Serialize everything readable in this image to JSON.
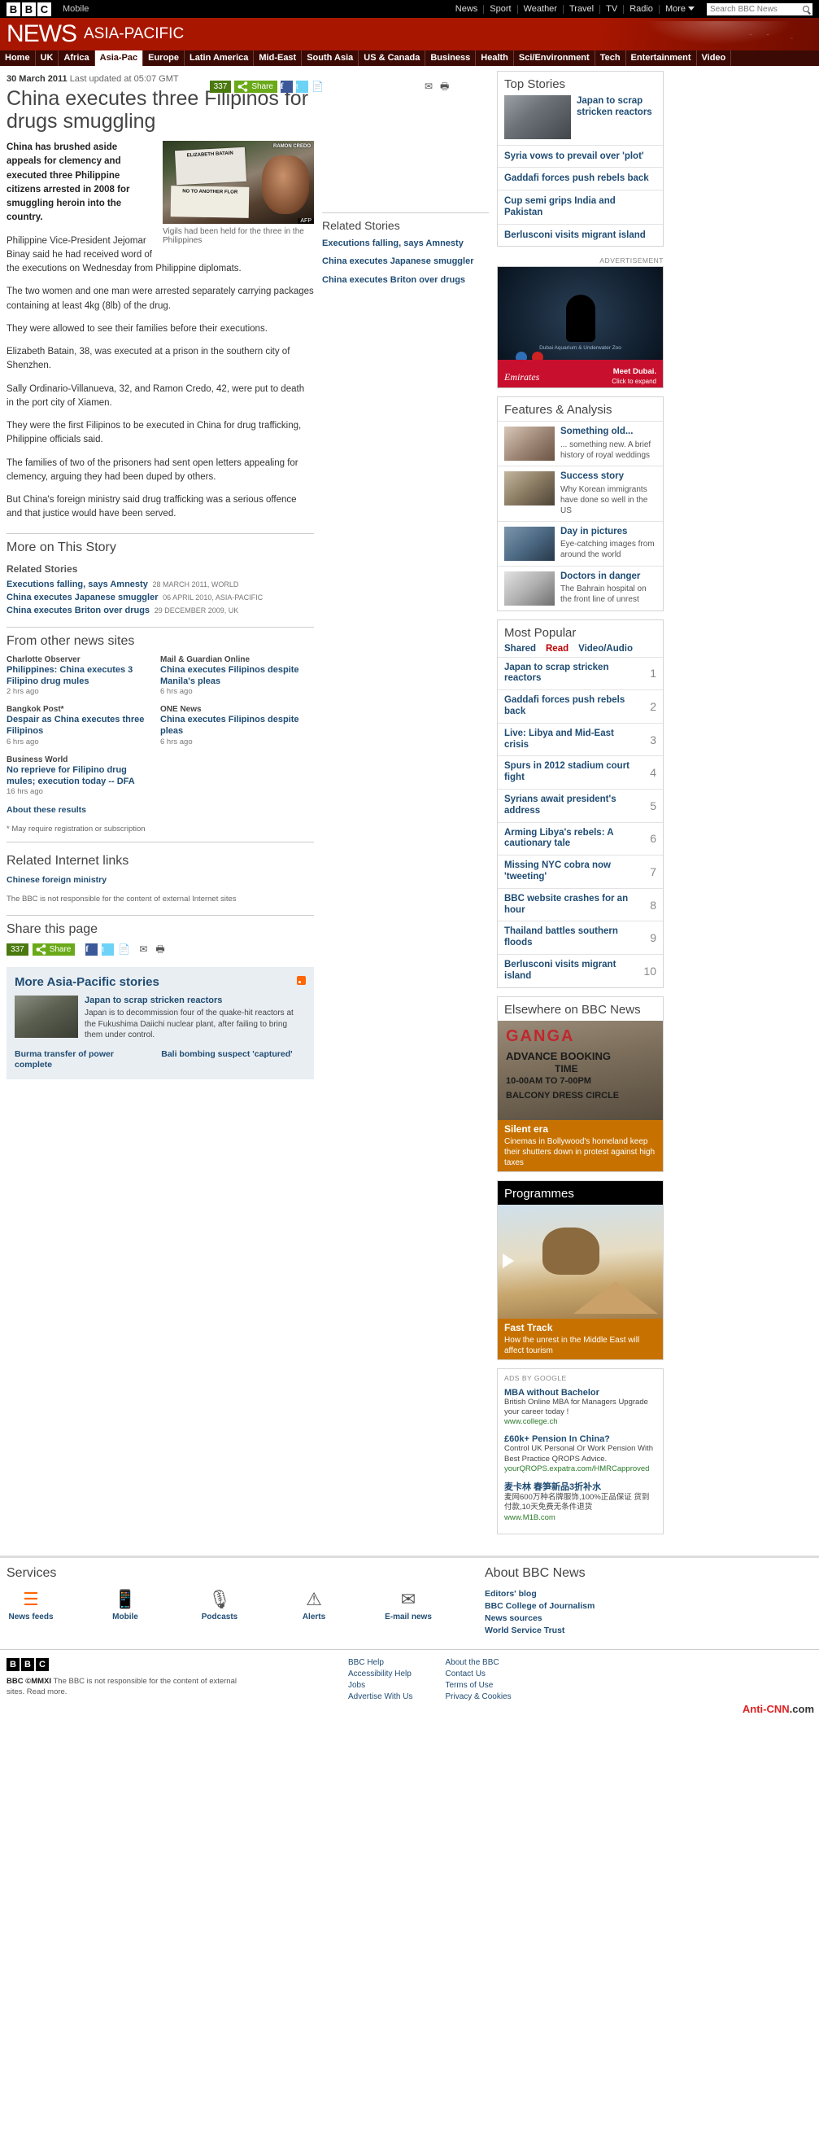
{
  "globalbar": {
    "logo_letters": [
      "B",
      "B",
      "C"
    ],
    "mobile_label": "Mobile",
    "nav": [
      "News",
      "Sport",
      "Weather",
      "Travel",
      "TV",
      "Radio",
      "More"
    ],
    "search_placeholder": "Search BBC News"
  },
  "masthead": {
    "brand": "NEWS",
    "section": "ASIA-PACIFIC"
  },
  "sectionnav": {
    "items": [
      {
        "label": "Home",
        "active": false
      },
      {
        "label": "UK",
        "active": false
      },
      {
        "label": "Africa",
        "active": false
      },
      {
        "label": "Asia-Pac",
        "active": true
      },
      {
        "label": "Europe",
        "active": false
      },
      {
        "label": "Latin America",
        "active": false
      },
      {
        "label": "Mid-East",
        "active": false
      },
      {
        "label": "South Asia",
        "active": false
      },
      {
        "label": "US & Canada",
        "active": false
      },
      {
        "label": "Business",
        "active": false
      },
      {
        "label": "Health",
        "active": false
      },
      {
        "label": "Sci/Environment",
        "active": false
      },
      {
        "label": "Tech",
        "active": false
      },
      {
        "label": "Entertainment",
        "active": false
      },
      {
        "label": "Video",
        "active": false
      }
    ]
  },
  "story": {
    "date": "30 March 2011",
    "updated": "Last updated at 05:07 GMT",
    "headline": "China executes three Filipinos for drugs smuggling",
    "share": {
      "count": "337",
      "label": "Share"
    },
    "figure": {
      "placard_text": "ELIZABETH BATAIN",
      "placard2_text": "NO TO ANOTHER FLOR",
      "nameplate": "RAMON CREDO",
      "agency": "AFP",
      "caption": "Vigils had been held for the three in the Philippines"
    },
    "paragraphs": [
      "China has brushed aside appeals for clemency and executed three Philippine citizens arrested in 2008 for smuggling heroin into the country.",
      "Philippine Vice-President Jejomar Binay said he had received word of the executions on Wednesday from Philippine diplomats.",
      "The two women and one man were arrested separately carrying packages containing at least 4kg (8lb) of the drug.",
      "They were allowed to see their families before their executions.",
      "Elizabeth Batain, 38, was executed at a prison in the southern city of Shenzhen.",
      "Sally Ordinario-Villanueva, 32, and Ramon Credo, 42, were put to death in the port city of Xiamen.",
      "They were the first Filipinos to be executed in China for drug trafficking, Philippine officials said.",
      "The families of two of the prisoners had sent open letters appealing for clemency, arguing they had been duped by others.",
      "But China's foreign ministry said drug trafficking was a serious offence and that justice would have been served."
    ],
    "more_heading": "More on This Story",
    "related_heading": "Related Stories",
    "related": [
      {
        "title": "Executions falling, says Amnesty",
        "meta": "28 MARCH 2011, WORLD"
      },
      {
        "title": "China executes Japanese smuggler",
        "meta": "06 APRIL 2010, ASIA-PACIFIC"
      },
      {
        "title": "China executes Briton over drugs",
        "meta": "29 DECEMBER 2009, UK"
      }
    ],
    "othersites_heading": "From other news sites",
    "othersites": [
      {
        "source": "Charlotte Observer",
        "title": "Philippines: China executes 3 Filipino drug mules",
        "age": "2 hrs ago"
      },
      {
        "source": "Mail & Guardian Online",
        "title": "China executes Filipinos despite Manila's pleas",
        "age": "6 hrs ago"
      },
      {
        "source": "Bangkok Post*",
        "title": "Despair as China executes three Filipinos",
        "age": "6 hrs ago"
      },
      {
        "source": "ONE News",
        "title": "China executes Filipinos despite pleas",
        "age": "6 hrs ago"
      },
      {
        "source": "Business World",
        "title": "No reprieve for Filipino drug mules; execution today -- DFA",
        "age": "16 hrs ago"
      }
    ],
    "about_results": "About these results",
    "registration_note": "* May require registration or subscription",
    "internet_links_heading": "Related Internet links",
    "internet_links": [
      "Chinese foreign ministry"
    ],
    "disclaimer": "The BBC is not responsible for the content of external Internet sites",
    "share_page_heading": "Share this page"
  },
  "related_column": {
    "heading": "Related Stories",
    "items": [
      "Executions falling, says Amnesty",
      "China executes Japanese smuggler",
      "China executes Briton over drugs"
    ]
  },
  "more_stories": {
    "heading": "More Asia-Pacific stories",
    "rss": "rss-icon",
    "lead_title": "Japan to scrap stricken reactors",
    "lead_summary": "Japan is to decommission four of the quake-hit reactors at the Fukushima Daiichi nuclear plant, after failing to bring them under control.",
    "links": [
      "Burma transfer of power complete",
      "Bali bombing suspect 'captured'"
    ]
  },
  "top_stories": {
    "heading": "Top Stories",
    "lead": "Japan to scrap stricken reactors",
    "items": [
      "Syria vows to prevail over 'plot'",
      "Gaddafi forces push rebels back",
      "Cup semi grips India and Pakistan",
      "Berlusconi visits migrant island"
    ]
  },
  "advert": {
    "label": "ADVERTISEMENT",
    "caption": "Dubai Aquarium & Underwater Zoo",
    "brand": "Emirates",
    "cta_line1": "Meet Dubai.",
    "cta_line2": "Click to expand"
  },
  "features": {
    "heading": "Features & Analysis",
    "items": [
      {
        "title": "Something old...",
        "desc": "... something new. A brief history of royal weddings"
      },
      {
        "title": "Success story",
        "desc": "Why Korean immigrants have done so well in the US"
      },
      {
        "title": "Day in pictures",
        "desc": "Eye-catching images from around the world"
      },
      {
        "title": "Doctors in danger",
        "desc": "The Bahrain hospital on the front line of unrest"
      }
    ]
  },
  "most_popular": {
    "heading": "Most Popular",
    "tabs": [
      {
        "label": "Shared",
        "active": false
      },
      {
        "label": "Read",
        "active": true
      },
      {
        "label": "Video/Audio",
        "active": false
      }
    ],
    "items": [
      {
        "rank": "1",
        "title": "Japan to scrap stricken reactors"
      },
      {
        "rank": "2",
        "title": "Gaddafi forces push rebels back"
      },
      {
        "rank": "3",
        "title": "Live: Libya and Mid-East crisis"
      },
      {
        "rank": "4",
        "title": "Spurs in 2012 stadium court fight"
      },
      {
        "rank": "5",
        "title": "Syrians await president's address"
      },
      {
        "rank": "6",
        "title": "Arming Libya's rebels: A cautionary tale"
      },
      {
        "rank": "7",
        "title": "Missing NYC cobra now 'tweeting'"
      },
      {
        "rank": "8",
        "title": "BBC website crashes for an hour"
      },
      {
        "rank": "9",
        "title": "Thailand battles southern floods"
      },
      {
        "rank": "10",
        "title": "Berlusconi visits migrant island"
      }
    ]
  },
  "elsewhere": {
    "heading": "Elsewhere on BBC News",
    "title": "Silent era",
    "desc": "Cinemas in Bollywood's homeland keep their shutters down in protest against high taxes",
    "image_text_1": "GANGA",
    "image_text_2": "ADVANCE BOOKING",
    "image_text_3": "TIME",
    "image_text_4": "10-00AM TO 7-00PM",
    "image_text_5": "BALCONY    DRESS CIRCLE"
  },
  "programmes": {
    "heading": "Programmes",
    "title": "Fast Track",
    "desc": "How the unrest in the Middle East will affect tourism"
  },
  "ads_by_google": {
    "label": "ADS BY GOOGLE",
    "items": [
      {
        "title": "MBA without Bachelor",
        "desc": "British Online MBA for Managers Upgrade your career today !",
        "url": "www.college.ch"
      },
      {
        "title": "£60k+ Pension In China?",
        "desc": "Control UK Personal Or Work Pension With Best Practice QROPS Advice.",
        "url": "yourQROPS.expatra.com/HMRCapproved"
      },
      {
        "title": "麦卡林 春笋新品3折补水",
        "desc": "麦网600万种名牌服饰,100%正品保证 货到付款,10天免费无条件退货",
        "url": "www.M1B.com"
      }
    ]
  },
  "services": {
    "heading": "Services",
    "items": [
      {
        "label": "News feeds",
        "icon": "rss-icon",
        "glyph": "▤"
      },
      {
        "label": "Mobile",
        "icon": "mobile-icon",
        "glyph": "▯"
      },
      {
        "label": "Podcasts",
        "icon": "podcast-icon",
        "glyph": "▮"
      },
      {
        "label": "Alerts",
        "icon": "alert-icon",
        "glyph": "⚠"
      },
      {
        "label": "E-mail news",
        "icon": "email-icon",
        "glyph": "✉"
      }
    ]
  },
  "about": {
    "heading": "About BBC News",
    "items": [
      "Editors' blog",
      "BBC College of Journalism",
      "News sources",
      "World Service Trust"
    ]
  },
  "footer": {
    "logo_letters": [
      "B",
      "B",
      "C"
    ],
    "copyright": "BBC ©MMXI",
    "copy_text": "The BBC is not responsible for the content of external sites. Read more.",
    "links_col1": [
      "BBC Help",
      "Accessibility Help",
      "Jobs",
      "Advertise With Us"
    ],
    "links_col2": [
      "About the BBC",
      "Contact Us",
      "Terms of Use",
      "Privacy & Cookies"
    ],
    "watermark_a": "Anti-CNN",
    "watermark_b": ".com"
  }
}
